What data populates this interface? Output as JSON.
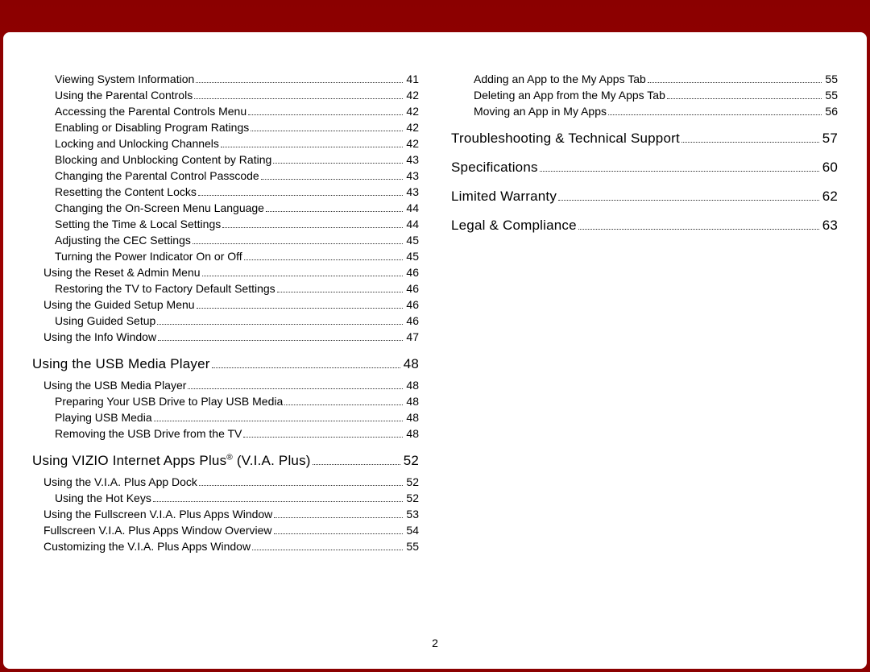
{
  "page_number": "2",
  "columns": [
    [
      {
        "title": "Viewing System Information",
        "page": "41",
        "indent": 2
      },
      {
        "title": "Using the Parental Controls",
        "page": "42",
        "indent": 2
      },
      {
        "title": "Accessing the Parental Controls Menu",
        "page": "42",
        "indent": 2
      },
      {
        "title": "Enabling or Disabling Program Ratings",
        "page": "42",
        "indent": 2
      },
      {
        "title": "Locking and Unlocking Channels",
        "page": "42",
        "indent": 2
      },
      {
        "title": "Blocking and Unblocking Content by Rating",
        "page": "43",
        "indent": 2
      },
      {
        "title": "Changing the Parental Control Passcode",
        "page": "43",
        "indent": 2
      },
      {
        "title": "Resetting the Content Locks",
        "page": "43",
        "indent": 2
      },
      {
        "title": "Changing the On-Screen Menu Language",
        "page": "44",
        "indent": 2
      },
      {
        "title": "Setting the Time & Local Settings",
        "page": "44",
        "indent": 2
      },
      {
        "title": "Adjusting the CEC Settings",
        "page": "45",
        "indent": 2
      },
      {
        "title": "Turning the Power Indicator On or Off",
        "page": "45",
        "indent": 2
      },
      {
        "title": "Using the Reset & Admin Menu",
        "page": "46",
        "indent": 1
      },
      {
        "title": "Restoring the TV to Factory Default Settings",
        "page": "46",
        "indent": 2
      },
      {
        "title": "Using the Guided Setup Menu",
        "page": "46",
        "indent": 1
      },
      {
        "title": "Using Guided Setup",
        "page": "46",
        "indent": 2
      },
      {
        "title": "Using the Info Window",
        "page": "47",
        "indent": 1
      },
      {
        "title": "Using the USB Media Player",
        "page": "48",
        "indent": 0,
        "section": true
      },
      {
        "title": "Using the USB Media Player",
        "page": "48",
        "indent": 1
      },
      {
        "title": "Preparing Your USB Drive to Play USB Media",
        "page": "48",
        "indent": 2
      },
      {
        "title": "Playing USB Media",
        "page": "48",
        "indent": 2
      },
      {
        "title": "Removing the USB Drive from the TV",
        "page": "48",
        "indent": 2
      },
      {
        "title": "Using VIZIO Internet Apps Plus® (V.I.A. Plus)",
        "page": "52",
        "indent": 0,
        "section": true
      },
      {
        "title": "Using the V.I.A. Plus App Dock",
        "page": "52",
        "indent": 1
      },
      {
        "title": "Using the Hot Keys",
        "page": "52",
        "indent": 2
      },
      {
        "title": "Using the Fullscreen V.I.A. Plus Apps Window",
        "page": "53",
        "indent": 1
      },
      {
        "title": "Fullscreen V.I.A. Plus Apps Window Overview",
        "page": "54",
        "indent": 1
      },
      {
        "title": "Customizing the V.I.A. Plus Apps Window",
        "page": "55",
        "indent": 1
      }
    ],
    [
      {
        "title": "Adding an App to the My Apps Tab",
        "page": "55",
        "indent": 2
      },
      {
        "title": "Deleting an App from the My Apps Tab",
        "page": "55",
        "indent": 2
      },
      {
        "title": "Moving an App in My Apps",
        "page": "56",
        "indent": 2
      },
      {
        "title": "Troubleshooting & Technical Support",
        "page": "57",
        "indent": 0,
        "section": true
      },
      {
        "title": "Specifications",
        "page": "60",
        "indent": 0,
        "section": true
      },
      {
        "title": "Limited Warranty",
        "page": "62",
        "indent": 0,
        "section": true
      },
      {
        "title": "Legal & Compliance",
        "page": "63",
        "indent": 0,
        "section": true
      }
    ]
  ]
}
